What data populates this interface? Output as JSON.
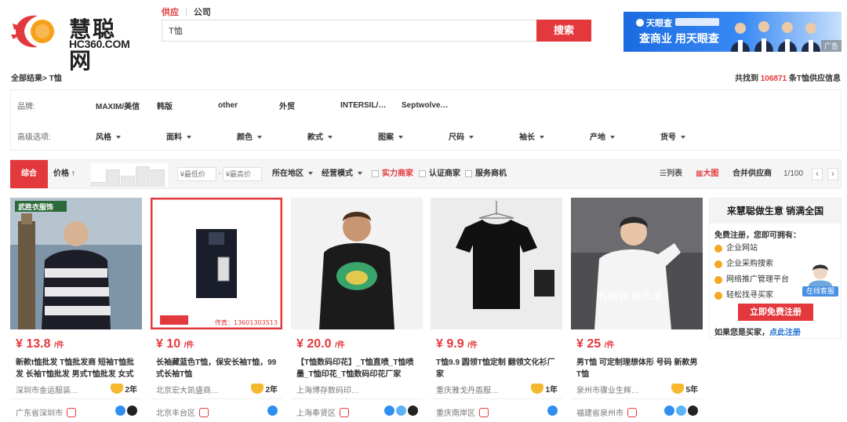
{
  "logo": {
    "cn_name": "慧聪网",
    "domain": "HC360.COM"
  },
  "search": {
    "tabs": [
      "供应",
      "公司"
    ],
    "query": "T恤",
    "button": "搜索"
  },
  "ad": {
    "brand": "天眼查",
    "headline": "查商业 用天眼查",
    "tag": "广告"
  },
  "results": {
    "breadcrumb": "全部结果> T恤",
    "count_prefix": "共找到 ",
    "count": "106871",
    "count_suffix": " 条T恤供应信息"
  },
  "filters": {
    "brand_label": "品牌:",
    "brands": [
      "MAXIM/美信",
      "韩版",
      "other",
      "外贸",
      "INTERSIL/…",
      "Septwolve…"
    ],
    "advanced_label": "高级选项:",
    "options": [
      "风格",
      "面料",
      "颜色",
      "款式",
      "图案",
      "尺码",
      "袖长",
      "产地",
      "货号"
    ]
  },
  "sortbar": {
    "default": "综合",
    "price": "价格",
    "price_arrow": "↑",
    "min_price": "¥最低价",
    "range_sep": "-",
    "max_price": "¥最高价",
    "region": "所在地区",
    "mode": "经营模式",
    "checks": [
      "实力商家",
      "认证商家",
      "服务商机"
    ],
    "list_view": "列表",
    "grid_view": "大图",
    "merge": "合并供应商",
    "page": "1/100",
    "prev": "‹",
    "next": "›"
  },
  "products": [
    {
      "price": "13.8",
      "unit": "/件",
      "title": "新款t恤批发 T恤批发商 短袖T恤批发 长袖T恤批发 男式T恤批发 女式T恤批",
      "company": "深圳市金运服装…",
      "years": "2年",
      "location": "广东省深圳市",
      "image_text": "武胜衣服饰"
    },
    {
      "price": "10",
      "unit": "/件",
      "title": "长袖藏蓝色T恤，保安长袖T恤，99式长袖T恤",
      "company": "北京宏大凯盛商…",
      "years": "2年",
      "location": "北京丰台区",
      "image_text": "传真：13601303513"
    },
    {
      "price": "20.0",
      "unit": "/件",
      "title": "【T恤数码印花】_T恤直喷_T恤喷墨_T恤印花_T恤数码印花厂家",
      "company": "上海博存数码印…",
      "years": "",
      "location": "上海奉贤区",
      "image_text": ""
    },
    {
      "price": "9.9",
      "unit": "/件",
      "title": "T恤9.9 圆领T恤定制 翻领文化衫厂家",
      "company": "重庆雅戈丹盾服…",
      "years": "1年",
      "location": "重庆南岸区",
      "image_text": ""
    },
    {
      "price": "25",
      "unit": "/件",
      "title": "男T恤 可定制理想体形 号码 新款男T恤",
      "company": "泉州市骤业生辉…",
      "years": "5年",
      "location": "福建省泉州市",
      "image_text": "有脑调·新风潮"
    }
  ],
  "price_prefix": "¥",
  "side": {
    "title": "来慧聪做生意 销满全国",
    "subtitle": "免费注册，您即可拥有：",
    "items": [
      "企业网站",
      "企业采购搜索",
      "网络推广管理平台",
      "轻松找寻买家"
    ],
    "cs_label": "在线客服",
    "register": "立即免费注册",
    "buyer_prompt": "如果您是买家，",
    "buyer_link": "点此注册"
  },
  "colors": {
    "accent": "#e4393c",
    "link": "#1a6fd1",
    "badge": "#f5b82e"
  }
}
